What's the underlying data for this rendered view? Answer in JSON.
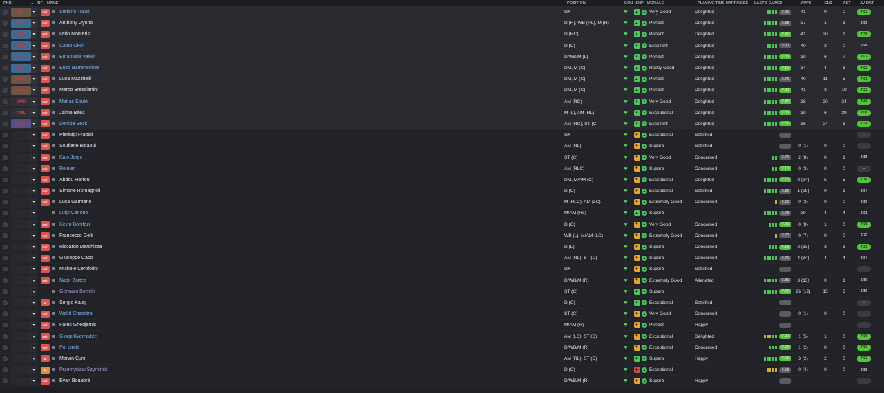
{
  "headers": {
    "pkd": "PKD",
    "sort": "▲",
    "inf": "INF",
    "name": "NAME",
    "position": "POSITION",
    "con": "CON",
    "shp": "SHP",
    "morale": "MORALE",
    "pth": "PLAYING TIME HAPPINESS",
    "last5": "LAST 5 GAMES",
    "apps": "APPS",
    "gls": "GLS",
    "ast": "AST",
    "avrat": "AV RAT"
  },
  "colors": {
    "pos_box_blue": "#3e6a92",
    "pos_box_purple": "#56508a",
    "pos_box_brown": "#6a5548",
    "pos_text_red": "#c93a3a",
    "badge_red": "#d9534f",
    "badge_orange": "#e08a3c",
    "heart_green": "#56d26b",
    "morale_green": "#46c05a",
    "shp_green": "#4cc35f",
    "shp_orange": "#e8a23a",
    "shp_red": "#d94848",
    "rating_green": "#55c23a",
    "rating_lightgreen": "#8ccf3a",
    "rating_gray": "#5a5c62",
    "name_blue": "#7fb2e8",
    "name_purple": "#b39ad8"
  },
  "icons": {
    "radio": "radio-dot-icon",
    "chevron": "chevron-down-icon",
    "player": "player-head-icon",
    "condition": "heart-icon",
    "sharpness": "sharpness-icon",
    "morale": "morale-face-icon",
    "injury": "injury-badge-icon"
  },
  "players": [
    {
      "pos": "GK",
      "pos_style": "brown",
      "inf": "Hol",
      "name": "Stefano Turati",
      "name_color": "blue",
      "position": "GK",
      "shp": "green",
      "morale": "Very Good",
      "pth": "Delighted",
      "l5": "gggg",
      "rating": "6.96",
      "rating_color": "gray",
      "apps": "41",
      "gls": "0",
      "ast": "0",
      "av": "7.02",
      "av_color": "green"
    },
    {
      "pos": "DR",
      "pos_style": "blue",
      "inf": "Hol",
      "name": "Anthony Oyono",
      "name_color": "white",
      "position": "D (R), WB (RL), M (R)",
      "shp": "green",
      "morale": "Perfect",
      "pth": "Delighted",
      "l5": "ggggl",
      "rating": "6.88",
      "rating_color": "gray",
      "apps": "37",
      "gls": "1",
      "ast": "3",
      "av": "6.99",
      "av_color": "none"
    },
    {
      "pos": "DCR",
      "pos_style": "blue",
      "inf": "Hol",
      "name": "Ilario Monterisi",
      "name_color": "white",
      "position": "D (RC)",
      "shp": "green",
      "morale": "Perfect",
      "pth": "Delighted",
      "l5": "ggggg",
      "rating": "7.45",
      "rating_color": "green",
      "apps": "41",
      "gls": "20",
      "ast": "1",
      "av": "7.36",
      "av_color": "green"
    },
    {
      "pos": "DCL",
      "pos_style": "blue",
      "inf": "Hol",
      "name": "Caleb Okoli",
      "name_color": "blue",
      "position": "D (C)",
      "shp": "green",
      "morale": "Excellent",
      "pth": "Delighted",
      "l5": "gggg",
      "rating": "6.90",
      "rating_color": "gray",
      "apps": "40",
      "gls": "2",
      "ast": "0",
      "av": "6.96",
      "av_color": "none"
    },
    {
      "pos": "DL",
      "pos_style": "blue",
      "inf": "Hol",
      "name": "Emanuele Valeri",
      "name_color": "blue",
      "position": "D/WB/M (L)",
      "shp": "green",
      "morale": "Perfect",
      "pth": "Delighted",
      "l5": "ggggg",
      "rating": "7.35",
      "rating_color": "green",
      "apps": "39",
      "gls": "6",
      "ast": "7",
      "av": "7.07",
      "av_color": "green"
    },
    {
      "pos": "DM",
      "pos_style": "blue",
      "inf": "Hol",
      "name": "Enzo Barrenechea",
      "name_color": "blue",
      "position": "DM, M (C)",
      "shp": "green",
      "morale": "Really Good",
      "pth": "Delighted",
      "l5": "ggggg",
      "rating": "7.16",
      "rating_color": "green",
      "apps": "34",
      "gls": "4",
      "ast": "6",
      "av": "7.02",
      "av_color": "green"
    },
    {
      "pos": "MCR",
      "pos_style": "brown",
      "inf": "Hol",
      "name": "Luca Mazzitelli",
      "name_color": "white",
      "position": "DM, M (C)",
      "shp": "green",
      "morale": "Perfect",
      "pth": "Delighted",
      "l5": "ggggg",
      "rating": "6.76",
      "rating_color": "gray",
      "apps": "40",
      "gls": "11",
      "ast": "5",
      "av": "7.01",
      "av_color": "green"
    },
    {
      "pos": "MCL",
      "pos_style": "brown",
      "inf": "Hol",
      "name": "Marco Brescianini",
      "name_color": "white",
      "position": "DM, M (C)",
      "shp": "green",
      "morale": "Perfect",
      "pth": "Delighted",
      "l5": "ggggg",
      "rating": "7.30",
      "rating_color": "green",
      "apps": "41",
      "gls": "3",
      "ast": "10",
      "av": "7.22",
      "av_color": "green"
    },
    {
      "pos": "AMR",
      "pos_style": "none",
      "inf": "Hol",
      "name": "Matías Soulé",
      "name_color": "blue",
      "position": "AM (RC)",
      "shp": "green",
      "morale": "Very Good",
      "pth": "Delighted",
      "l5": "ggggg",
      "rating": "7.42",
      "rating_color": "green",
      "apps": "38",
      "gls": "20",
      "ast": "24",
      "av": "7.49",
      "av_color": "green"
    },
    {
      "pos": "AML",
      "pos_style": "none",
      "inf": "Hol",
      "name": "Jaime Báez",
      "name_color": "white",
      "position": "M (L), AM (RL)",
      "shp": "green",
      "morale": "Exceptional",
      "pth": "Delighted",
      "l5": "ggggg",
      "rating": "7.35",
      "rating_color": "green",
      "apps": "39",
      "gls": "6",
      "ast": "20",
      "av": "7.06",
      "av_color": "green"
    },
    {
      "pos": "STC",
      "pos_style": "purple",
      "inf": "Hol",
      "name": "Demba Seck",
      "name_color": "blue",
      "position": "AM (RC), ST (C)",
      "shp": "green",
      "morale": "Excellent",
      "pth": "Delighted",
      "l5": "ggggg",
      "rating": "7.56",
      "rating_color": "green",
      "apps": "36",
      "gls": "24",
      "ast": "6",
      "av": "7.34",
      "av_color": "green"
    },
    {
      "pos": "",
      "pos_style": "none",
      "inf": "Hol",
      "name": "Pierluigi Frattali",
      "name_color": "white",
      "position": "GK",
      "shp": "orange",
      "morale": "Exceptional",
      "pth": "Satisfied",
      "l5": "",
      "rating": "-",
      "rating_color": "gray",
      "apps": "-",
      "gls": "-",
      "ast": "-",
      "av": "-",
      "av_color": "gray"
    },
    {
      "pos": "",
      "pos_style": "none",
      "inf": "Hol",
      "name": "Soufiane Bidaoui",
      "name_color": "white",
      "position": "AM (RL)",
      "shp": "orange",
      "morale": "Superb",
      "pth": "Satisfied",
      "l5": "",
      "rating": "-",
      "rating_color": "gray",
      "apps": "0 (1)",
      "gls": "0",
      "ast": "0",
      "av": "-",
      "av_color": "gray"
    },
    {
      "pos": "",
      "pos_style": "none",
      "inf": "Hol",
      "name": "Kaio Jorge",
      "name_color": "blue",
      "position": "ST (C)",
      "shp": "orange",
      "morale": "Very Good",
      "pth": "Concerned",
      "l5": "gg",
      "rating": "6.76",
      "rating_color": "gray",
      "apps": "2 (8)",
      "gls": "0",
      "ast": "1",
      "av": "6.65",
      "av_color": "none"
    },
    {
      "pos": "",
      "pos_style": "none",
      "inf": "Hol",
      "name": "Reinier",
      "name_color": "blue",
      "position": "AM (RLC)",
      "shp": "orange",
      "morale": "Superb",
      "pth": "Concerned",
      "l5": "gg",
      "rating": "7.10",
      "rating_color": "green",
      "apps": "0 (3)",
      "gls": "0",
      "ast": "0",
      "av": "-",
      "av_color": "gray"
    },
    {
      "pos": "",
      "pos_style": "none",
      "inf": "Hol",
      "name": "Abdou Harroui",
      "name_color": "white",
      "position": "DM, M/AM (C)",
      "shp": "orange",
      "morale": "Exceptional",
      "pth": "Delighted",
      "l5": "ggggg",
      "rating": "7.20",
      "rating_color": "green",
      "apps": "8 (24)",
      "gls": "5",
      "ast": "5",
      "av": "7.16",
      "av_color": "green"
    },
    {
      "pos": "",
      "pos_style": "none",
      "inf": "Hol",
      "name": "Simone Romagnoli",
      "name_color": "white",
      "position": "D (C)",
      "shp": "orange",
      "morale": "Exceptional",
      "pth": "Satisfied",
      "l5": "ggggg",
      "rating": "6.86",
      "rating_color": "gray",
      "apps": "1 (29)",
      "gls": "0",
      "ast": "1",
      "av": "6.94",
      "av_color": "none"
    },
    {
      "pos": "",
      "pos_style": "none",
      "inf": "Hol",
      "name": "Luca Garritano",
      "name_color": "white",
      "position": "M (RLC), AM (LC)",
      "shp": "orange",
      "morale": "Extremely Good",
      "pth": "Concerned",
      "l5": "y",
      "rating": "6.60",
      "rating_color": "gray",
      "apps": "0 (3)",
      "gls": "0",
      "ast": "0",
      "av": "6.60",
      "av_color": "none"
    },
    {
      "pos": "",
      "pos_style": "none",
      "inf": "",
      "name": "Luigi Canotto",
      "name_color": "blue",
      "position": "M/AM (RL)",
      "shp": "green",
      "morale": "Superb",
      "pth": "",
      "l5": "ggggg",
      "rating": "6.78",
      "rating_color": "gray",
      "apps": "39",
      "gls": "4",
      "ast": "4",
      "av": "6.91",
      "av_color": "none"
    },
    {
      "pos": "",
      "pos_style": "none",
      "inf": "Hol",
      "name": "Kevin Bonifazi",
      "name_color": "blue",
      "position": "D (C)",
      "shp": "orange",
      "morale": "Very Good",
      "pth": "Concerned",
      "l5": "ggg",
      "rating": "7.05",
      "rating_color": "green",
      "apps": "0 (8)",
      "gls": "1",
      "ast": "0",
      "av": "7.05",
      "av_color": "green"
    },
    {
      "pos": "",
      "pos_style": "none",
      "inf": "Hol",
      "name": "Francesco Gelli",
      "name_color": "white",
      "position": "WB (L), M/AM (LC)",
      "shp": "orange",
      "morale": "Extremely Good",
      "pth": "Concerned",
      "l5": "y",
      "rating": "6.70",
      "rating_color": "gray",
      "apps": "0 (7)",
      "gls": "0",
      "ast": "0",
      "av": "6.70",
      "av_color": "none"
    },
    {
      "pos": "",
      "pos_style": "none",
      "inf": "Hol",
      "name": "Riccardo Marchizza",
      "name_color": "white",
      "position": "D (L)",
      "shp": "orange",
      "morale": "Superb",
      "pth": "Concerned",
      "l5": "ggg",
      "rating": "7.18",
      "rating_color": "green",
      "apps": "2 (33)",
      "gls": "3",
      "ast": "3",
      "av": "7.20",
      "av_color": "green"
    },
    {
      "pos": "",
      "pos_style": "none",
      "inf": "Hol",
      "name": "Giuseppe Caso",
      "name_color": "white",
      "position": "AM (RL), ST (C)",
      "shp": "orange",
      "morale": "Superb",
      "pth": "Concerned",
      "l5": "ggggg",
      "rating": "6.76",
      "rating_color": "gray",
      "apps": "4 (34)",
      "gls": "4",
      "ast": "4",
      "av": "6.94",
      "av_color": "none"
    },
    {
      "pos": "",
      "pos_style": "none",
      "inf": "Hol",
      "name": "Michele Cerofolini",
      "name_color": "white",
      "position": "GK",
      "shp": "orange",
      "morale": "Superb",
      "pth": "Satisfied",
      "l5": "",
      "rating": "-",
      "rating_color": "gray",
      "apps": "-",
      "gls": "-",
      "ast": "-",
      "av": "-",
      "av_color": "gray"
    },
    {
      "pos": "",
      "pos_style": "none",
      "inf": "Hol",
      "name": "Nadir Zortea",
      "name_color": "blue",
      "position": "D/WB/M (R)",
      "shp": "orange",
      "morale": "Extremely Good",
      "pth": "Alienated",
      "l5": "ggggg",
      "rating": "6.86",
      "rating_color": "gray",
      "apps": "3 (13)",
      "gls": "0",
      "ast": "1",
      "av": "6.89",
      "av_color": "none"
    },
    {
      "pos": "",
      "pos_style": "none",
      "inf": "",
      "name": "Gennaro Borrelli",
      "name_color": "purple",
      "position": "ST (C)",
      "shp": "green",
      "morale": "Superb",
      "pth": "",
      "l5": "ggggg",
      "rating": "7.06",
      "rating_color": "green",
      "apps": "26 (12)",
      "gls": "15",
      "ast": "3",
      "av": "6.89",
      "av_color": "none"
    },
    {
      "pos": "",
      "pos_style": "none",
      "inf": "Inj",
      "name": "Sergio Kalaj",
      "name_color": "white",
      "position": "D (C)",
      "shp": "green",
      "morale": "Exceptional",
      "pth": "Satisfied",
      "l5": "",
      "rating": "-",
      "rating_color": "gray",
      "apps": "-",
      "gls": "-",
      "ast": "-",
      "av": "-",
      "av_color": "gray"
    },
    {
      "pos": "",
      "pos_style": "none",
      "inf": "Hol",
      "name": "Walid Cheddira",
      "name_color": "blue",
      "position": "ST (C)",
      "shp": "orange",
      "morale": "Very Good",
      "pth": "Concerned",
      "l5": "",
      "rating": "-",
      "rating_color": "gray",
      "apps": "0 (1)",
      "gls": "0",
      "ast": "0",
      "av": "-",
      "av_color": "gray"
    },
    {
      "pos": "",
      "pos_style": "none",
      "inf": "Hol",
      "name": "Farès Ghedjemis",
      "name_color": "white",
      "position": "M/AM (R)",
      "shp": "orange",
      "morale": "Perfect",
      "pth": "Happy",
      "l5": "",
      "rating": "-",
      "rating_color": "gray",
      "apps": "-",
      "gls": "-",
      "ast": "-",
      "av": "-",
      "av_color": "gray"
    },
    {
      "pos": "",
      "pos_style": "none",
      "inf": "Hol",
      "name": "Giorgi Kvernadze",
      "name_color": "blue",
      "position": "AM (LC), ST (C)",
      "shp": "orange",
      "morale": "Exceptional",
      "pth": "Delighted",
      "l5": "yyygg",
      "rating": "7.00",
      "rating_color": "green",
      "apps": "1 (5)",
      "gls": "1",
      "ast": "0",
      "av": "7.06",
      "av_color": "green"
    },
    {
      "pos": "",
      "pos_style": "none",
      "inf": "Hol",
      "name": "Pol Lirola",
      "name_color": "blue",
      "position": "D/WB/M (R)",
      "shp": "orange",
      "morale": "Exceptional",
      "pth": "Concerned",
      "l5": "ggg",
      "rating": "7.00",
      "rating_color": "green",
      "apps": "1 (2)",
      "gls": "0",
      "ast": "0",
      "av": "7.00",
      "av_color": "green"
    },
    {
      "pos": "",
      "pos_style": "none",
      "inf": "Inj",
      "name": "Marvin Çuni",
      "name_color": "white",
      "position": "AM (RL), ST (C)",
      "shp": "green",
      "morale": "Superb",
      "pth": "Happy",
      "l5": "ggggg",
      "rating": "7.03",
      "rating_color": "green",
      "apps": "3 (2)",
      "gls": "2",
      "ast": "0",
      "av": "7.03",
      "av_color": "green"
    },
    {
      "pos": "",
      "pos_style": "none",
      "inf": "Inj",
      "inf_color": "orange",
      "name": "Przemysław Szymiński",
      "name_color": "purple",
      "position": "D (C)",
      "shp": "red",
      "morale": "Exceptional",
      "pth": "",
      "l5": "yyyy",
      "rating": "6.58",
      "rating_color": "gray",
      "apps": "0 (4)",
      "gls": "0",
      "ast": "0",
      "av": "6.58",
      "av_color": "none"
    },
    {
      "pos": "",
      "pos_style": "none",
      "inf": "Hol",
      "name": "Evan Bouabré",
      "name_color": "white",
      "position": "D/WB/M (R)",
      "shp": "orange",
      "morale": "Superb",
      "pth": "Happy",
      "l5": "",
      "rating": "-",
      "rating_color": "gray",
      "apps": "-",
      "gls": "-",
      "ast": "-",
      "av": "-",
      "av_color": "gray"
    }
  ]
}
